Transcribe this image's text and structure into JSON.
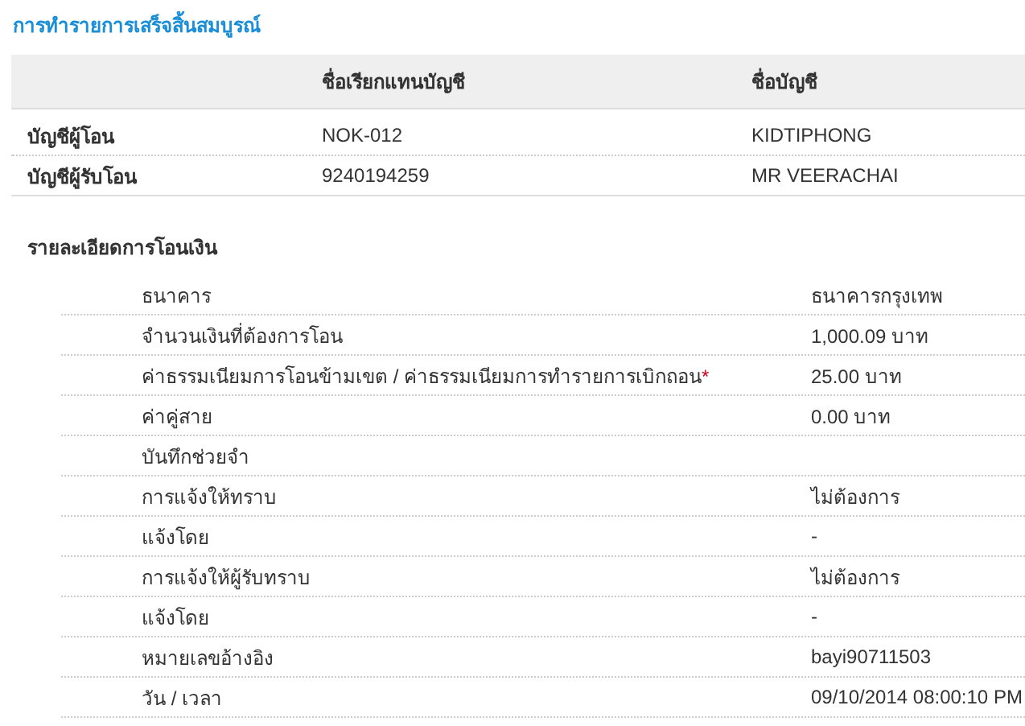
{
  "title": "การทำรายการเสร็จสิ้นสมบูรณ์",
  "accounts": {
    "columns": [
      "ชื่อเรียกแทนบัญชี",
      "ชื่อบัญชี"
    ],
    "rows": [
      {
        "label": "บัญชีผู้โอน",
        "nickname": "NOK-012",
        "name": "KIDTIPHONG"
      },
      {
        "label": "บัญชีผู้รับโอน",
        "nickname": "9240194259",
        "name": "MR VEERACHAI"
      }
    ]
  },
  "details": {
    "title": "รายละเอียดการโอนเงิน",
    "rows": [
      {
        "label": "ธนาคาร",
        "value": "ธนาคารกรุงเทพ"
      },
      {
        "label": "จำนวนเงินที่ต้องการโอน",
        "value": "1,000.09 บาท"
      },
      {
        "label": "ค่าธรรมเนียมการโอนข้ามเขต / ค่าธรรมเนียมการทำรายการเบิกถอน",
        "marker": "*",
        "value": "25.00 บาท"
      },
      {
        "label": "ค่าคู่สาย",
        "value": "0.00 บาท"
      },
      {
        "label": "บันทึกช่วยจำ"
      },
      {
        "label": "การแจ้งให้ทราบ",
        "value": "ไม่ต้องการ"
      },
      {
        "label": "แจ้งโดย",
        "value": "-"
      },
      {
        "label": "การแจ้งให้ผู้รับทราบ",
        "value": "ไม่ต้องการ"
      },
      {
        "label": "แจ้งโดย",
        "value": "-"
      },
      {
        "label": "หมายเลขอ้างอิง",
        "value": "bayi90711503"
      },
      {
        "label": "วัน / เวลา",
        "value": "09/10/2014 08:00:10 PM"
      }
    ]
  }
}
